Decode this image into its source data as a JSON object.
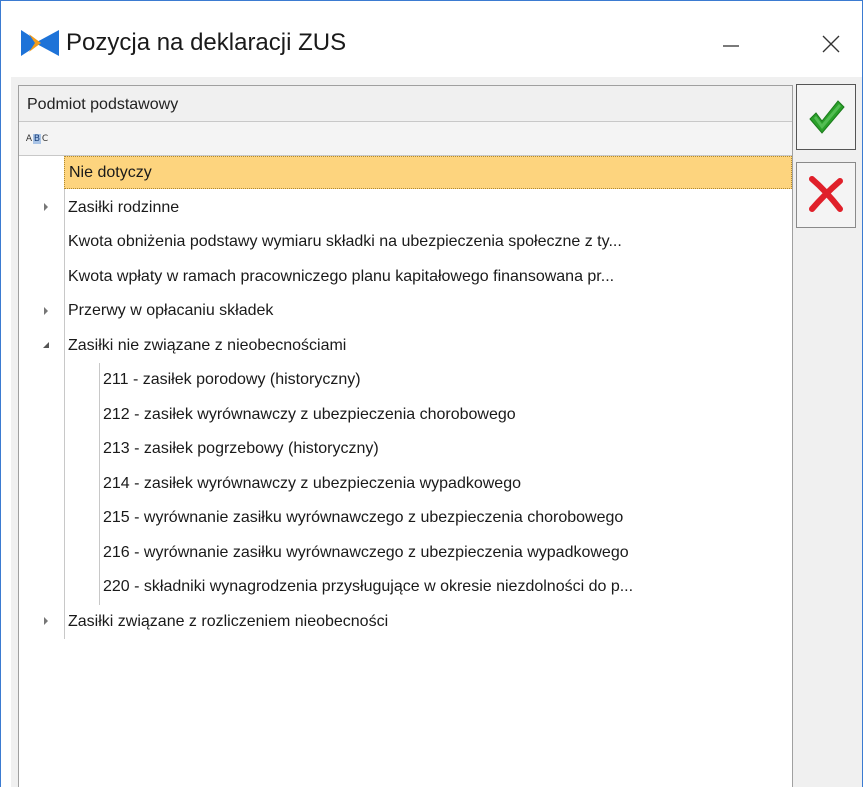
{
  "window": {
    "title": "Pozycja na deklaracji ZUS",
    "minimize_icon": "minimize-icon",
    "close_icon": "close-icon"
  },
  "panel": {
    "group_header": "Podmiot podstawowy",
    "sort_icon": "abc-sort-icon",
    "sort_letters": [
      "A",
      "B",
      "C"
    ]
  },
  "tree": {
    "items": [
      {
        "label": "Nie dotyczy",
        "level": 0,
        "expander": "none",
        "selected": true
      },
      {
        "label": "Zasiłki rodzinne",
        "level": 0,
        "expander": "collapsed"
      },
      {
        "label": "Kwota obniżenia podstawy wymiaru składki na ubezpieczenia społeczne z ty...",
        "level": 0,
        "expander": "none"
      },
      {
        "label": "Kwota wpłaty w ramach pracowniczego planu kapitałowego finansowana pr...",
        "level": 0,
        "expander": "none"
      },
      {
        "label": "Przerwy w opłacaniu składek",
        "level": 0,
        "expander": "collapsed"
      },
      {
        "label": "Zasiłki nie związane z nieobecnościami",
        "level": 0,
        "expander": "expanded"
      },
      {
        "label": "211 - zasiłek porodowy (historyczny)",
        "level": 1,
        "expander": "none"
      },
      {
        "label": "212 - zasiłek wyrównawczy z ubezpieczenia chorobowego",
        "level": 1,
        "expander": "none"
      },
      {
        "label": "213 - zasiłek pogrzebowy (historyczny)",
        "level": 1,
        "expander": "none"
      },
      {
        "label": "214 - zasiłek wyrównawczy z ubezpieczenia wypadkowego",
        "level": 1,
        "expander": "none"
      },
      {
        "label": "215 - wyrównanie zasiłku wyrównawczego z ubezpieczenia chorobowego",
        "level": 1,
        "expander": "none"
      },
      {
        "label": "216 - wyrównanie zasiłku wyrównawczego z ubezpieczenia wypadkowego",
        "level": 1,
        "expander": "none"
      },
      {
        "label": "220 - składniki wynagrodzenia przysługujące w okresie niezdolności do p...",
        "level": 1,
        "expander": "none"
      },
      {
        "label": "Zasiłki związane z rozliczeniem nieobecności",
        "level": 0,
        "expander": "collapsed"
      }
    ]
  },
  "actions": {
    "ok_icon": "checkmark-icon",
    "cancel_icon": "cross-icon"
  },
  "colors": {
    "selected_row": "#fdd47e",
    "ok_green": "#2aa02a",
    "cancel_red": "#e0202a",
    "logo_blue": "#1e73d8",
    "logo_orange": "#f39c1b"
  }
}
